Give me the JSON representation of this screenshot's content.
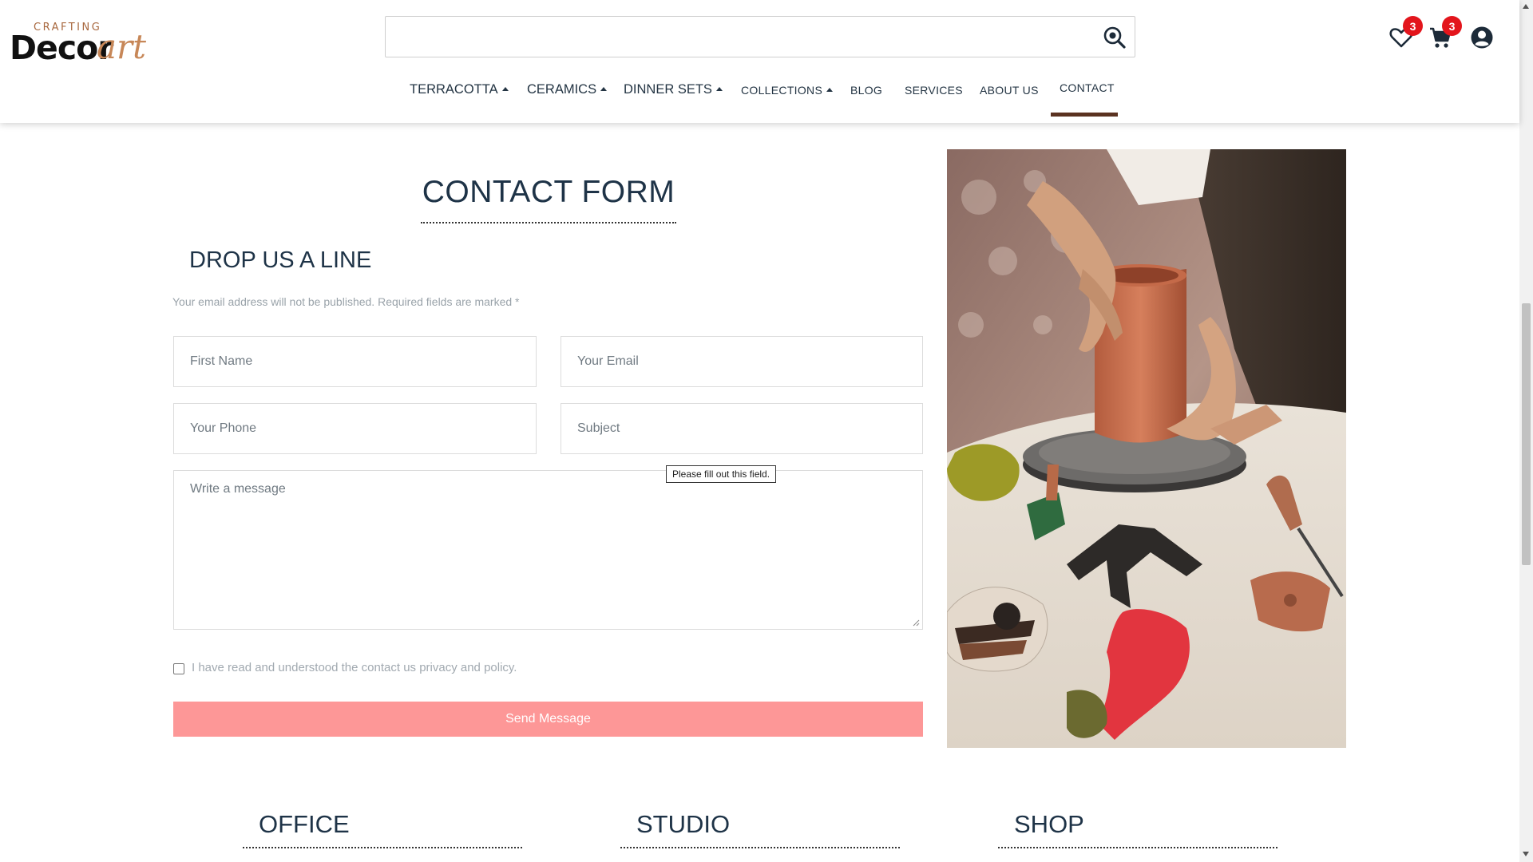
{
  "logo": {
    "tagline": "CRAFTING",
    "word": "Decor",
    "script": "art"
  },
  "search": {
    "placeholder": "",
    "value": ""
  },
  "header_icons": {
    "wishlist": {
      "icon": "heart-icon",
      "count": "3"
    },
    "cart": {
      "icon": "cart-icon",
      "count": "3"
    },
    "account": {
      "icon": "user-icon"
    }
  },
  "nav": {
    "items": [
      {
        "label": "TERRACOTTA",
        "dropdown": true
      },
      {
        "label": "CERAMICS",
        "dropdown": true
      },
      {
        "label": "DINNER SETS",
        "dropdown": true
      },
      {
        "label": "COLLECTIONS",
        "dropdown": true
      },
      {
        "label": "BLOG",
        "dropdown": false
      },
      {
        "label": "SERVICES",
        "dropdown": false
      },
      {
        "label": "ABOUT US",
        "dropdown": false
      },
      {
        "label": "CONTACT",
        "dropdown": false,
        "active": true
      }
    ]
  },
  "form": {
    "title": "CONTACT FORM",
    "subtitle": "DROP US A LINE",
    "note": "Your email address will not be published. Required fields are marked *",
    "fields": {
      "first_name": {
        "placeholder": "First Name",
        "value": ""
      },
      "email": {
        "placeholder": "Your Email",
        "value": ""
      },
      "phone": {
        "placeholder": "Your Phone",
        "value": ""
      },
      "subject": {
        "placeholder": "Subject",
        "value": ""
      },
      "message": {
        "placeholder": "Write a message",
        "value": ""
      }
    },
    "validation_tooltip": "Please fill out this field.",
    "privacy_label": "I have read and understood the contact us privacy and policy.",
    "privacy_checked": false,
    "submit_label": "Send Message"
  },
  "bottom_sections": {
    "office": "OFFICE",
    "studio": "STUDIO",
    "shop": "SHOP"
  },
  "colors": {
    "accent_button": "#fd9797",
    "badge": "#e3151c",
    "nav_active_underline": "#5a3220",
    "heading": "#1e3347",
    "logo_accent": "#c78758"
  }
}
